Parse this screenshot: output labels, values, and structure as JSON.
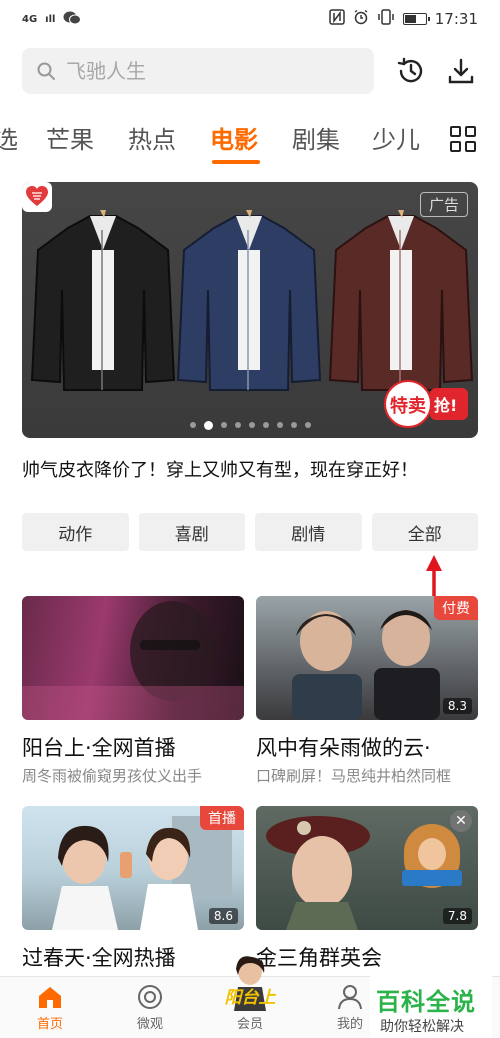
{
  "status_bar": {
    "network": "4G",
    "signal": "ıll",
    "time": "17:31",
    "battery_level": 0.55
  },
  "search": {
    "placeholder": "飞驰人生"
  },
  "tabs": [
    {
      "label": "选",
      "active": false
    },
    {
      "label": "芒果",
      "active": false
    },
    {
      "label": "热点",
      "active": false
    },
    {
      "label": "电影",
      "active": true
    },
    {
      "label": "剧集",
      "active": false
    },
    {
      "label": "少儿",
      "active": false
    }
  ],
  "banner": {
    "ad_label": "广告",
    "sale_text": "特卖",
    "grab_text": "抢!",
    "caption": "帅气皮衣降价了！穿上又帅又有型，现在穿正好！",
    "page_count": 9,
    "current_page": 2,
    "jacket_colors": [
      "#1f1f1f",
      "#2d3d63",
      "#5a2a26"
    ]
  },
  "genres": [
    "动作",
    "喜剧",
    "剧情",
    "全部"
  ],
  "videos": [
    {
      "title": "阳台上·全网首播",
      "desc": "周冬雨被偷窥男孩仗义出手",
      "tag": "",
      "score": ""
    },
    {
      "title": "风中有朵雨做的云·",
      "desc": "口碑刷屏！马思纯井柏然同框",
      "tag": "付费",
      "score": "8.3"
    },
    {
      "title": "过春天·全网热播",
      "desc": "",
      "tag": "首播",
      "score": "8.6"
    },
    {
      "title": "金三角群英会",
      "desc": "",
      "tag": "",
      "score": "7.8"
    }
  ],
  "bottom_nav": {
    "home": "首页",
    "micro": "微观",
    "vip": "会员",
    "vip_logo": "阳台上",
    "mine": "我的"
  },
  "watermark": {
    "title": "百科全说",
    "subtitle": "助你轻松解决"
  },
  "colors": {
    "accent": "#ff6a00",
    "tag_red": "#e8473b",
    "watermark_green": "#2bb34a"
  }
}
